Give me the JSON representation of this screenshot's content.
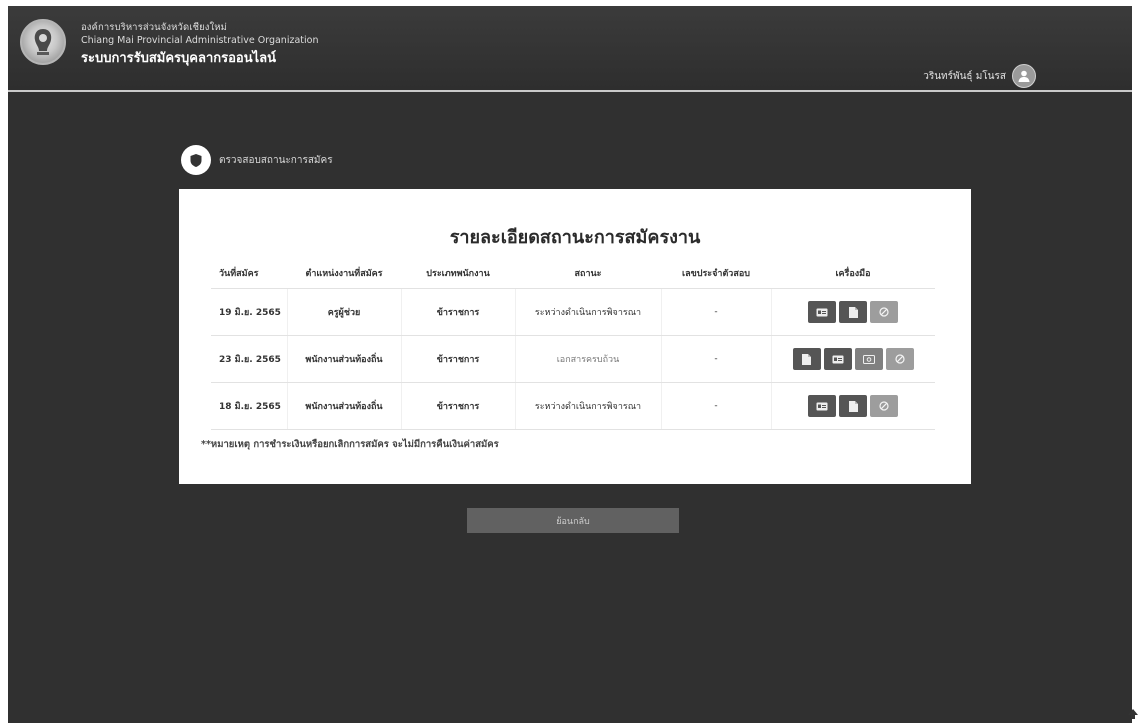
{
  "header": {
    "org_th": "องค์การบริหารส่วนจังหวัดเชียงใหม่",
    "org_en": "Chiang Mai Provincial Administrative Organization",
    "app_title": "ระบบการรับสมัครบุคลากรออนไลน์",
    "user_name": "วรินทร์พันธุ์ มโนรส"
  },
  "section": {
    "label": "ตรวจสอบสถานะการสมัคร"
  },
  "card": {
    "title": "รายละเอียดสถานะการสมัครงาน",
    "columns": [
      "วันที่สมัคร",
      "ตำแหน่งงานที่สมัคร",
      "ประเภทพนักงาน",
      "สถานะ",
      "เลขประจำตัวสอบ",
      "เครื่องมือ"
    ],
    "rows": [
      {
        "date": "19 มิ.ย. 2565",
        "position": "ครูผู้ช่วย",
        "type": "ข้าราชการ",
        "status": "ระหว่างดำเนินการพิจารณา",
        "exam_id": "-",
        "tools": [
          "id-card-icon",
          "document-icon",
          "cancel-icon"
        ]
      },
      {
        "date": "23 มิ.ย. 2565",
        "position": "พนักงานส่วนท้องถิ่น",
        "type": "ข้าราชการ",
        "status": "เอกสารครบถ้วน",
        "exam_id": "-",
        "tools": [
          "document-icon",
          "id-card-icon",
          "payment-icon",
          "cancel-icon"
        ]
      },
      {
        "date": "18 มิ.ย. 2565",
        "position": "พนักงานส่วนท้องถิ่น",
        "type": "ข้าราชการ",
        "status": "ระหว่างดำเนินการพิจารณา",
        "exam_id": "-",
        "tools": [
          "id-card-icon",
          "document-icon",
          "cancel-icon"
        ]
      }
    ],
    "note": "**หมายเหตุ การชำระเงินหรือยกเลิกการสมัคร จะไม่มีการคืนเงินค่าสมัคร"
  },
  "actions": {
    "back_label": "ย้อนกลับ"
  },
  "colors": {
    "page_bg": "#303030",
    "card_bg": "#ffffff",
    "button_dark": "#555555",
    "button_light": "#9d9d9d"
  }
}
